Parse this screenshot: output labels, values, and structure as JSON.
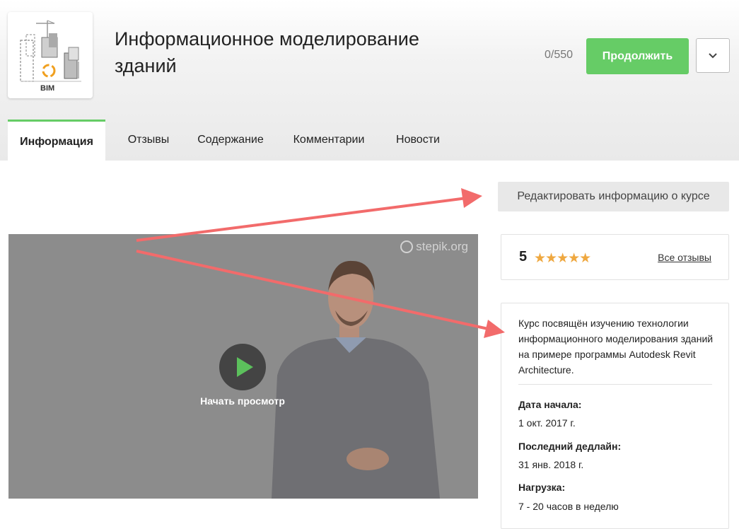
{
  "course": {
    "title_line1": "Информационное моделирование",
    "title_line2": "зданий",
    "logo_text": "BIM",
    "progress": "0/550",
    "continue_label": "Продолжить"
  },
  "tabs": [
    {
      "label": "Информация",
      "active": true
    },
    {
      "label": "Отзывы"
    },
    {
      "label": "Содержание"
    },
    {
      "label": "Комментарии"
    },
    {
      "label": "Новости"
    }
  ],
  "edit_button": "Редактировать информацию о курсе",
  "video": {
    "watermark": "stepik.org",
    "play_label": "Начать просмотр"
  },
  "rating": {
    "value": "5",
    "stars": "★★★★★",
    "all_reviews": "Все отзывы"
  },
  "info": {
    "description": "Курс посвящён изучению технологии информационного моделирования зданий на примере программы Autodesk Revit Architecture.",
    "start_label": "Дата начала:",
    "start_value": "1 окт. 2017 г.",
    "deadline_label": "Последний дедлайн:",
    "deadline_value": "31 янв. 2018 г.",
    "workload_label": "Нагрузка:",
    "workload_value": "7 - 20 часов в неделю"
  },
  "colors": {
    "accent_green": "#66cc66",
    "star_color": "#efa840",
    "arrow_color": "#f26b6b"
  },
  "icons": {
    "dropdown": "chevron-down-icon",
    "play": "play-icon",
    "watermark": "stepik-logo-icon",
    "logo": "bim-logo-icon"
  }
}
